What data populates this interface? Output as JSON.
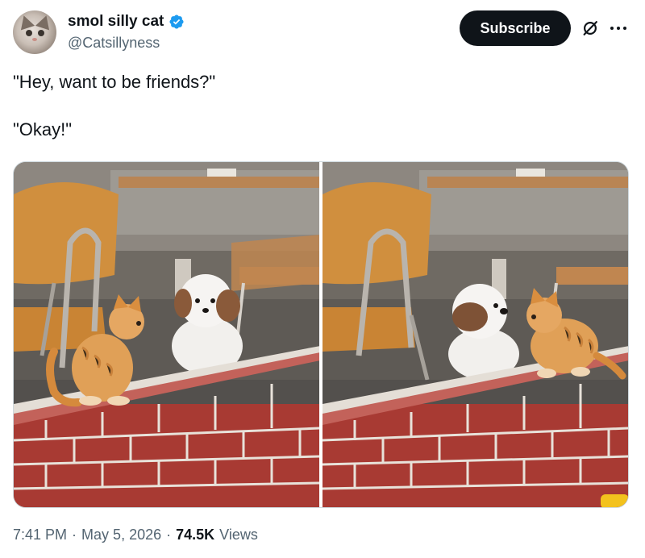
{
  "author": {
    "display_name": "smol silly cat",
    "handle": "@Catsillyness",
    "verified": true,
    "avatar_icon": "cat-avatar"
  },
  "actions": {
    "subscribe_label": "Subscribe",
    "grok_icon": "slashed-circle-icon",
    "more_icon": "more-horizontal-icon"
  },
  "tweet": {
    "lines": [
      "\"Hey, want to be friends?\"",
      "\"Okay!\""
    ]
  },
  "media": [
    {
      "alt": "kitten on brick ledge looking at puppy through window, puppy faces forward"
    },
    {
      "alt": "kitten on brick ledge, puppy now turned facing the kitten"
    }
  ],
  "meta": {
    "time": "7:41 PM",
    "sep1": "·",
    "date": "May 5, 2026",
    "sep2": "·",
    "views_count": "74.5K",
    "views_label": "Views"
  },
  "colors": {
    "text_primary": "#0f1419",
    "text_secondary": "#536471",
    "verified_blue": "#1d9bf0",
    "button_bg": "#0f1419"
  }
}
